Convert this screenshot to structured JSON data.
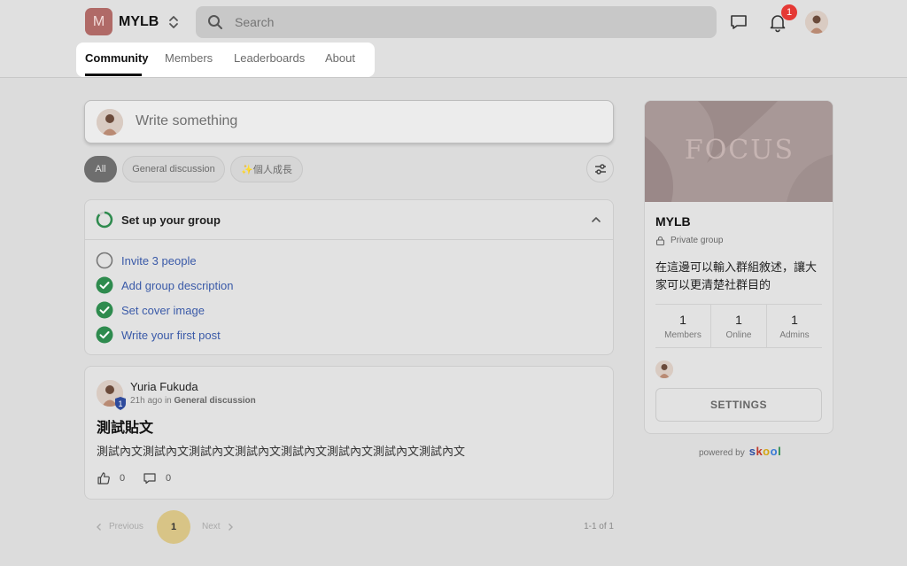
{
  "header": {
    "group_initial": "M",
    "group_name": "MYLB",
    "search_placeholder": "Search",
    "notification_count": "1"
  },
  "tabs": [
    {
      "label": "Community",
      "active": true
    },
    {
      "label": "Members",
      "active": false
    },
    {
      "label": "Leaderboards",
      "active": false
    },
    {
      "label": "About",
      "active": false
    }
  ],
  "composer": {
    "placeholder": "Write something"
  },
  "filters": [
    {
      "label": "All",
      "active": true
    },
    {
      "label": "General discussion",
      "active": false
    },
    {
      "label": "✨個人成長",
      "active": false
    }
  ],
  "setup": {
    "title": "Set up your group",
    "tasks": [
      {
        "label": "Invite 3 people",
        "done": false
      },
      {
        "label": "Add group description",
        "done": true
      },
      {
        "label": "Set cover image",
        "done": true
      },
      {
        "label": "Write your first post",
        "done": true
      }
    ]
  },
  "post": {
    "author": "Yuria Fukuda",
    "level": "1",
    "time": "21h ago",
    "in_word": "in",
    "category": "General discussion",
    "title": "測試貼文",
    "body": "測試內文測試內文測試內文測試內文測試內文測試內文測試內文測試內文",
    "likes": "0",
    "comments": "0"
  },
  "pagination": {
    "previous": "Previous",
    "current": "1",
    "next": "Next",
    "count": "1-1 of 1"
  },
  "sidebar": {
    "cover_text": "FOCUS",
    "name": "MYLB",
    "privacy": "Private group",
    "description": "在這邊可以輸入群組敘述，讓大家可以更清楚社群目的",
    "stats": [
      {
        "value": "1",
        "label": "Members"
      },
      {
        "value": "1",
        "label": "Online"
      },
      {
        "value": "1",
        "label": "Admins"
      }
    ],
    "settings_label": "SETTINGS"
  },
  "footer": {
    "powered_by": "powered by",
    "brand": "skool"
  },
  "colors": {
    "accent_link": "#3a5aa8",
    "check_green": "#2e8b4e",
    "notification_red": "#e53935",
    "page_highlight": "#d8c486"
  }
}
